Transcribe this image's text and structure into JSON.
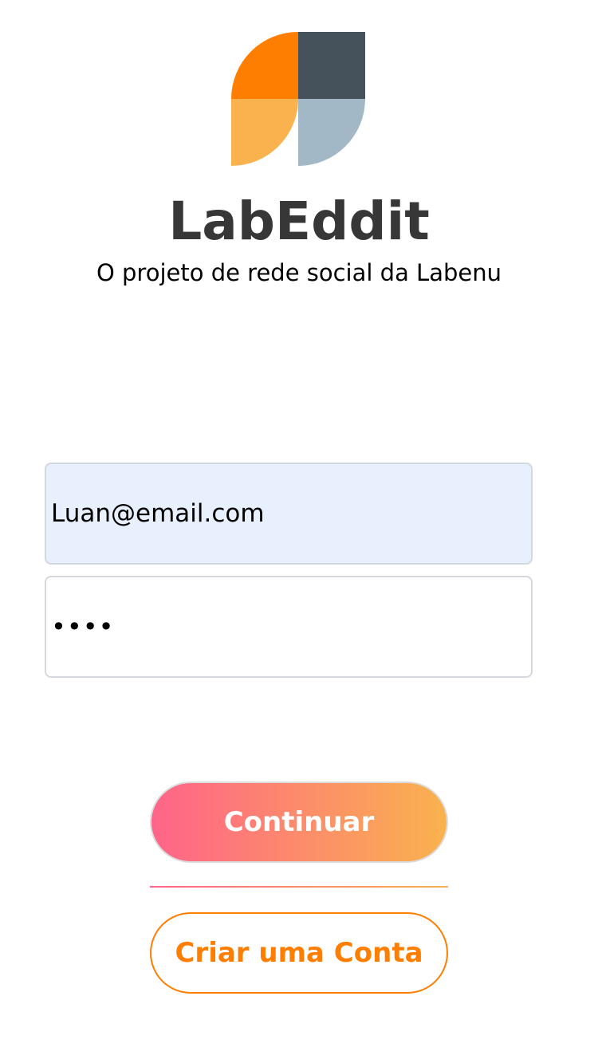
{
  "app": {
    "title": "LabEddit",
    "subtitle": "O projeto de rede social da Labenu"
  },
  "logo": {
    "icon": "labenu-logo-icon",
    "colors": {
      "top_left": "#fe7e02",
      "top_right": "#45525b",
      "bottom_left": "#f9b24e",
      "bottom_right": "#a3b8c6"
    }
  },
  "login_form": {
    "email_value": "Luan@email.com",
    "password_value": "••••"
  },
  "actions": {
    "continue_label": "Continuar",
    "create_account_label": "Criar uma Conta"
  },
  "colors": {
    "gradient_start": "#ff6489",
    "gradient_end": "#f9b24e",
    "accent_orange": "#fe7e02",
    "title_text": "#373737",
    "autofill_background": "#e8f0fe"
  }
}
